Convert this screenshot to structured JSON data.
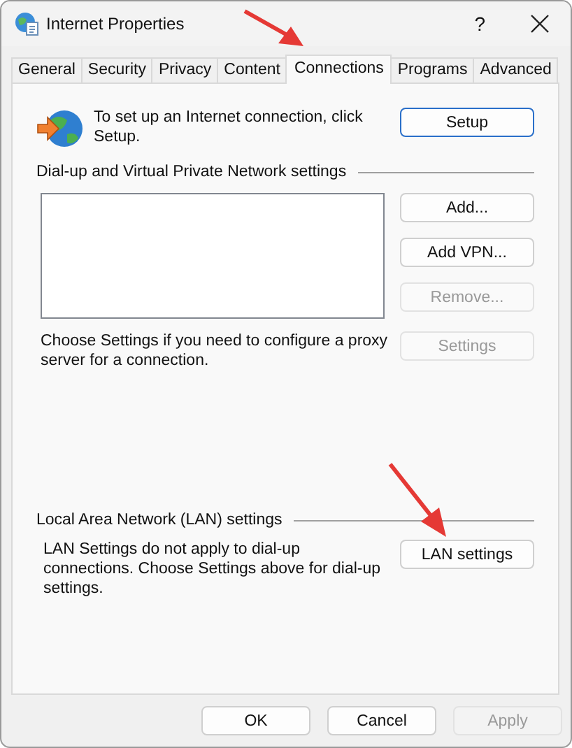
{
  "window": {
    "title": "Internet Properties",
    "help_label": "?"
  },
  "tabs": [
    {
      "label": "General",
      "selected": false
    },
    {
      "label": "Security",
      "selected": false
    },
    {
      "label": "Privacy",
      "selected": false
    },
    {
      "label": "Content",
      "selected": false
    },
    {
      "label": "Connections",
      "selected": true
    },
    {
      "label": "Programs",
      "selected": false
    },
    {
      "label": "Advanced",
      "selected": false
    }
  ],
  "setup": {
    "text": "To set up an Internet connection, click Setup.",
    "button": {
      "label": "Setup",
      "default": true,
      "disabled": false
    }
  },
  "dialup": {
    "heading": "Dial-up and Virtual Private Network settings",
    "buttons": [
      {
        "label": "Add...",
        "disabled": false
      },
      {
        "label": "Add VPN...",
        "disabled": false
      },
      {
        "label": "Remove...",
        "disabled": true
      }
    ],
    "proxy_text": "Choose Settings if you need to configure a proxy server for a connection.",
    "settings_button": {
      "label": "Settings",
      "disabled": true
    }
  },
  "lan": {
    "heading": "Local Area Network (LAN) settings",
    "text": "LAN Settings do not apply to dial-up connections. Choose Settings above for dial-up settings.",
    "button": {
      "label": "LAN settings",
      "disabled": false
    }
  },
  "buttons": [
    {
      "label": "OK",
      "disabled": false
    },
    {
      "label": "Cancel",
      "disabled": false
    },
    {
      "label": "Apply",
      "disabled": true
    }
  ]
}
